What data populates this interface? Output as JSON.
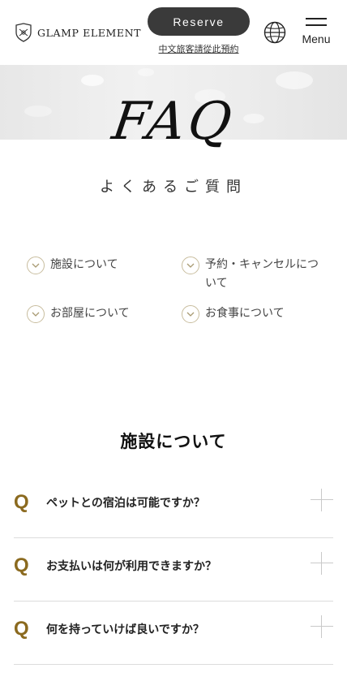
{
  "header": {
    "logo_text": "GLAMP ELEMENT",
    "reserve_label": "Reserve",
    "chinese_link": "中文旅客請從此預約",
    "menu_label": "Menu"
  },
  "hero": {
    "title": "FAQ",
    "subtitle": "よくあるご質問"
  },
  "categories": [
    {
      "label": "施設について"
    },
    {
      "label": "予約・キャンセルにつ"
    },
    {
      "label": "いて"
    },
    {
      "label": "お部屋について"
    },
    {
      "label": "お食事について"
    }
  ],
  "section": {
    "title": "施設について",
    "questions": [
      {
        "mark": "Q",
        "text": "ペットとの宿泊は可能ですか？"
      },
      {
        "mark": "Q",
        "text": "お支払いは何が利用できますか？"
      },
      {
        "mark": "Q",
        "text": "何を持っていけば良いですか？"
      }
    ]
  },
  "colors": {
    "accent_gold": "#8b6a1f",
    "reserve_bg": "#3a3a3a",
    "circle_border": "#c8bd9e"
  }
}
